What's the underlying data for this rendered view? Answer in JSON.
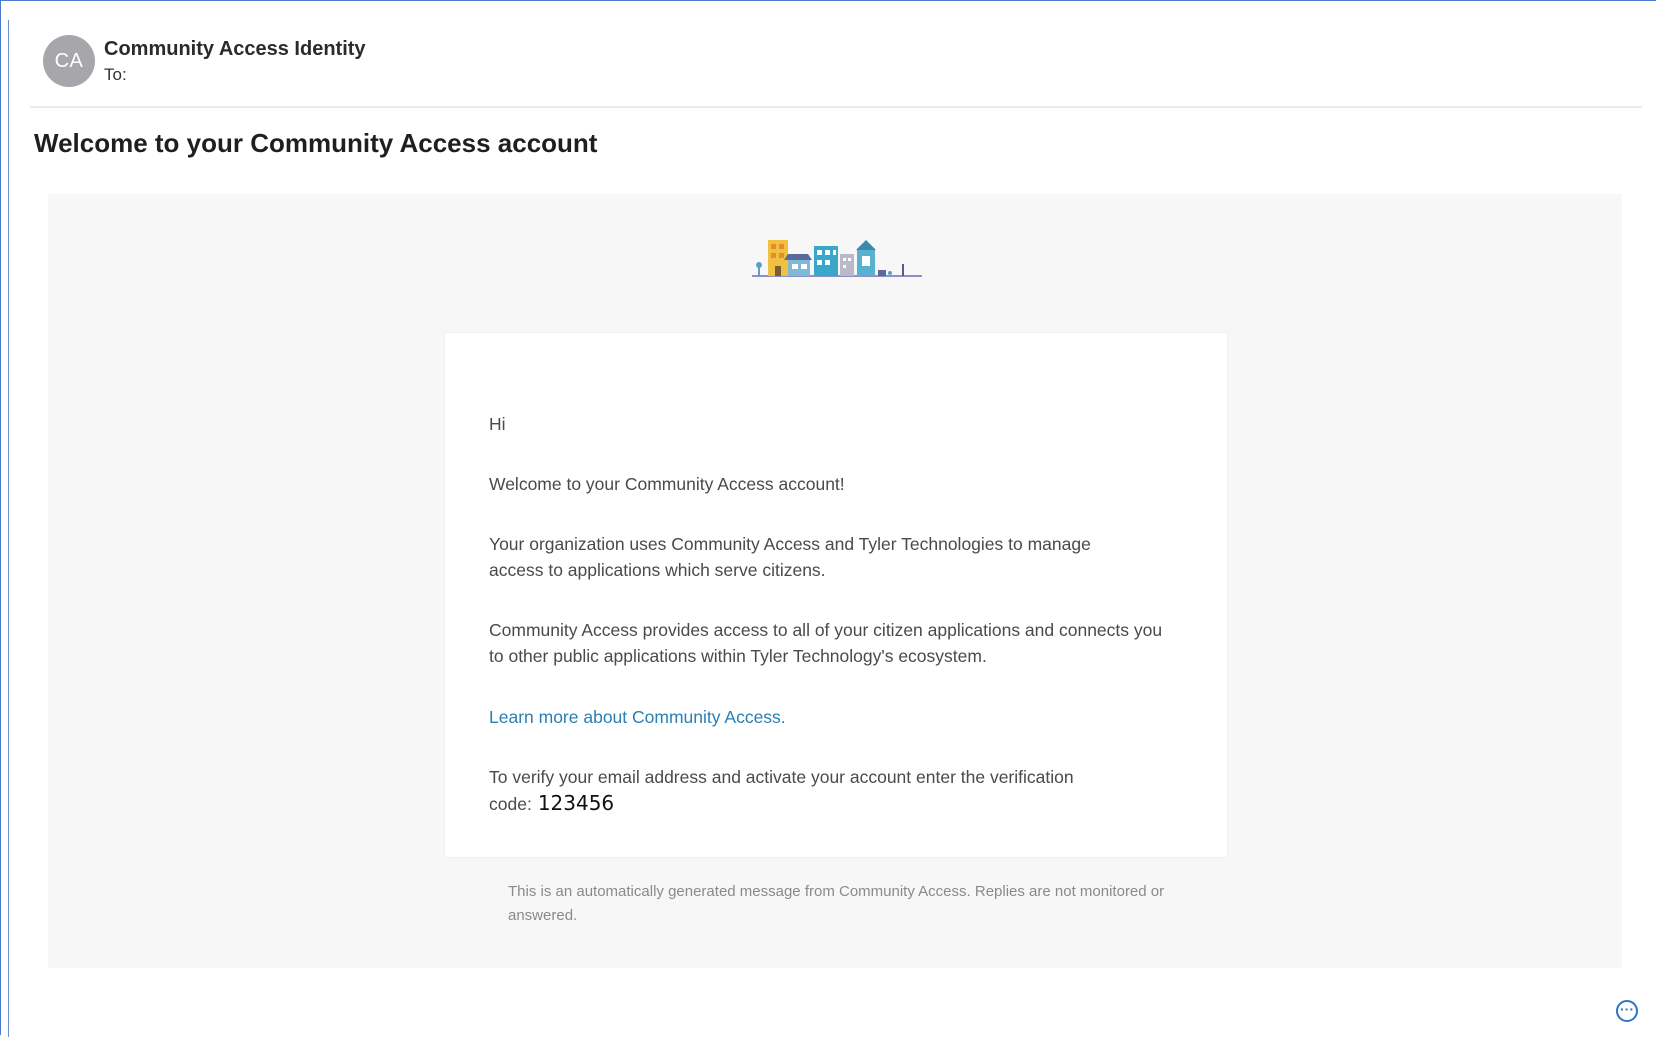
{
  "sender": {
    "initials": "CA",
    "name": "Community Access Identity",
    "to_label": "To:"
  },
  "subject": "Welcome to your Community Access account",
  "body": {
    "greeting": "Hi",
    "welcome": "Welcome to your Community Access account!",
    "para1": "Your organization uses Community Access and Tyler Technologies to manage access to applications which serve citizens.",
    "para2": "Community Access provides access to all of your citizen applications and connects you to other public applications within Tyler Technology's ecosystem.",
    "learn_more_link": "Learn more about Community Access.",
    "verify_text": "To verify your email address and activate your account enter the verification code:",
    "verification_code": "123456"
  },
  "footer_note": "This is an automatically generated message from Community Access. Replies are not monitored or answered.",
  "icons": {
    "logo": "town-buildings-logo",
    "more": "more-options-icon"
  },
  "colors": {
    "frame_border": "#4a7bd0",
    "avatar_bg": "#a7a7ab",
    "link": "#2a7fb5",
    "canvas_bg": "#f7f7f7"
  }
}
